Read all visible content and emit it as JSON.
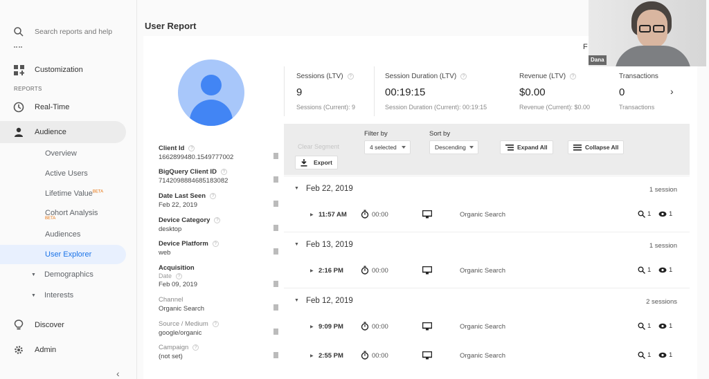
{
  "sidebar": {
    "search_placeholder": "Search reports and help",
    "customization": "Customization",
    "reports_label": "REPORTS",
    "realtime": "Real-Time",
    "audience": "Audience",
    "sub_items": [
      "Overview",
      "Active Users",
      "Lifetime Value",
      "Cohort Analysis",
      "Audiences",
      "User Explorer"
    ],
    "beta": "BETA",
    "demographics": "Demographics",
    "interests": "Interests",
    "discover": "Discover",
    "admin": "Admin"
  },
  "header": {
    "title": "User Report",
    "corner_text": "F"
  },
  "profile": {
    "client_id_label": "Client Id",
    "client_id": "1662899480.1549777002",
    "bq_label": "BigQuery Client ID",
    "bq_id": "7142098884685183082",
    "last_seen_label": "Date Last Seen",
    "last_seen": "Feb 22, 2019",
    "device_category_label": "Device Category",
    "device_category": "desktop",
    "device_platform_label": "Device Platform",
    "device_platform": "web",
    "acquisition_label": "Acquisition",
    "date_label": "Date",
    "acq_date": "Feb 09, 2019",
    "channel_label": "Channel",
    "channel": "Organic Search",
    "source_label": "Source / Medium",
    "source": "google/organic",
    "campaign_label": "Campaign",
    "campaign": "(not set)"
  },
  "metrics": [
    {
      "title": "Sessions (LTV)",
      "value": "9",
      "sub": "Sessions (Current): 9"
    },
    {
      "title": "Session Duration (LTV)",
      "value": "00:19:15",
      "sub": "Session Duration (Current): 00:19:15"
    },
    {
      "title": "Revenue (LTV)",
      "value": "$0.00",
      "sub": "Revenue (Current): $0.00"
    },
    {
      "title": "Transactions",
      "value": "0",
      "sub": "Transactions"
    }
  ],
  "toolbar": {
    "disabled_button": "Clear Segment",
    "export": "Export",
    "filter_label": "Filter by",
    "filter_value": "4 selected",
    "sort_label": "Sort by",
    "sort_value": "Descending",
    "expand_all": "Expand All",
    "collapse_all": "Collapse All"
  },
  "days": [
    {
      "date": "Feb 22, 2019",
      "count": "1 session",
      "sessions": [
        {
          "time": "11:57 AM",
          "duration": "00:00",
          "source": "Organic Search",
          "goals": "1",
          "views": "1"
        }
      ]
    },
    {
      "date": "Feb 13, 2019",
      "count": "1 session",
      "sessions": [
        {
          "time": "2:16 PM",
          "duration": "00:00",
          "source": "Organic Search",
          "goals": "1",
          "views": "1"
        }
      ]
    },
    {
      "date": "Feb 12, 2019",
      "count": "2 sessions",
      "sessions": [
        {
          "time": "9:09 PM",
          "duration": "00:00",
          "source": "Organic Search",
          "goals": "1",
          "views": "1"
        },
        {
          "time": "2:55 PM",
          "duration": "00:00",
          "source": "Organic Search",
          "goals": "1",
          "views": "1"
        }
      ]
    }
  ],
  "webcam": {
    "name": "Dana"
  }
}
